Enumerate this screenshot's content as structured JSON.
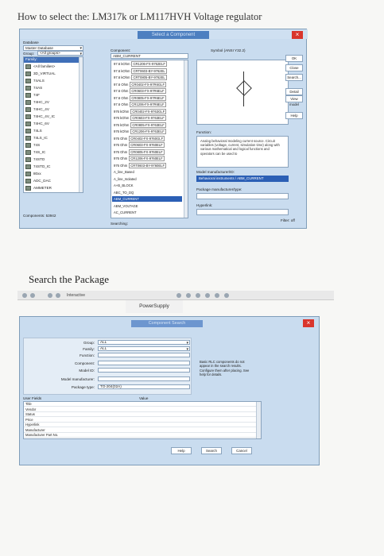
{
  "title": "How to select the: LM317k or LM117HVH Voltage regulator",
  "dialog1": {
    "banner": "Select a Component",
    "close": "×",
    "database_label": "Database",
    "master_database": "Master Database",
    "group_label": "Group:",
    "group_value": "<All groups>",
    "family_label": "Family:",
    "family_top": "<All families>",
    "families": [
      "3D_VIRTUAL",
      "74ALS",
      "74AS",
      "74F",
      "74HC_2V",
      "74HC_4V",
      "74HC_4V_IC",
      "74HC_6V",
      "74LS",
      "74LS_IC",
      "74S",
      "74S_IC",
      "74STD",
      "74STD_IC",
      "80xx",
      "ADC_DAC",
      "AMMETER"
    ],
    "component_label": "Component:",
    "component_value": "ABM_CURRENT",
    "components": [
      {
        "name": "97.6 kOhm",
        "part": "CR1206-FX-9762ELF"
      },
      {
        "name": "97.6 kOhm",
        "part": "CRT0603-BY-9762EL"
      },
      {
        "name": "97.6 kOhm",
        "part": "CRT0805-BY-9762EL"
      },
      {
        "name": "97.6 Ohm",
        "part": "CR0402-FX-97R6GLF"
      },
      {
        "name": "97.6 Ohm",
        "part": "CR0603-FX-97R6ELF"
      },
      {
        "name": "97.6 Ohm",
        "part": "CR0805-FX-97R6ELF"
      },
      {
        "name": "97.6 Ohm",
        "part": "CR1206-FX-97R6ELF"
      },
      {
        "name": "976 kOhm",
        "part": "CR0402-FX-9763GLF"
      },
      {
        "name": "976 kOhm",
        "part": "CR0603-FX-9763ELF"
      },
      {
        "name": "976 kOhm",
        "part": "CR0805-FX-9763ELF"
      },
      {
        "name": "976 kOhm",
        "part": "CR1206-FX-9763ELF"
      },
      {
        "name": "976 Ohm",
        "part": "CR0402-FX-9760GLF"
      },
      {
        "name": "976 Ohm",
        "part": "CR0603-FX-9760ELF"
      },
      {
        "name": "976 Ohm",
        "part": "CR0805-FX-9760ELF"
      },
      {
        "name": "976 Ohm",
        "part": "CR1206-FX-9760ELF"
      },
      {
        "name": "976 Ohm",
        "part": "CRT0603-BY-9760ELF"
      },
      {
        "name": "A_line_Based",
        "part": ""
      },
      {
        "name": "A_line_Isolated",
        "part": ""
      },
      {
        "name": "A+B_BLOCK",
        "part": ""
      },
      {
        "name": "ABC_TO_DQ",
        "part": ""
      },
      {
        "name": "ABM_CURRENT",
        "part": ""
      },
      {
        "name": "ABM_VOLTAGE",
        "part": ""
      },
      {
        "name": "AC_CURRENT",
        "part": ""
      }
    ],
    "selected_index": 20,
    "symbol_label": "Symbol (ANSI Y32.2)",
    "buttons": {
      "ok": "OK",
      "close": "Close",
      "search": "Search...",
      "detail": "Detail report",
      "view_model": "View model",
      "help": "Help"
    },
    "function_label": "Function:",
    "function_text": "Analog behavioral modeling current source. Circuit variables (voltage, current, simulation time) along with various mathematical and logical functions and operators can be used to",
    "model_manufacturer_label": "Model manufacturer/ID:",
    "model_manufacturer_value": "Behavioral instruments / ABM_CURRENT",
    "package_label": "Package manufacturer/type:",
    "hyperlink_label": "Hyperlink:",
    "components_count": "Components: 53942",
    "searching": "Searching:",
    "filter": "Filter: off"
  },
  "heading": "Search the Package",
  "toolbar2": {
    "interactive": "Interactive"
  },
  "powersupply_tab": "PowerSupply",
  "dialog2": {
    "banner": "Component Search",
    "close": "×",
    "group_label": "Group:",
    "group_value": "ALL",
    "family_label": "Family:",
    "family_value": "ALL",
    "function_label": "Function:",
    "component_label": "Component:",
    "model_id_label": "Model ID:",
    "model_mfr_label": "Model manufacturer:",
    "package_label": "Package type:",
    "package_value": "TO-204(02A)",
    "value_header": "Value",
    "user_fields_label": "User Fields",
    "user_fields": [
      "Title",
      "Vendor",
      "Status",
      "Price",
      "Hyperlink",
      "Manufacturer",
      "Manufacturer Part No."
    ],
    "note": "Basic RLC components do not appear in the search results. Configure them after placing. See help for details.",
    "buttons": {
      "help": "Help",
      "search": "Search",
      "cancel": "Cancel"
    }
  }
}
